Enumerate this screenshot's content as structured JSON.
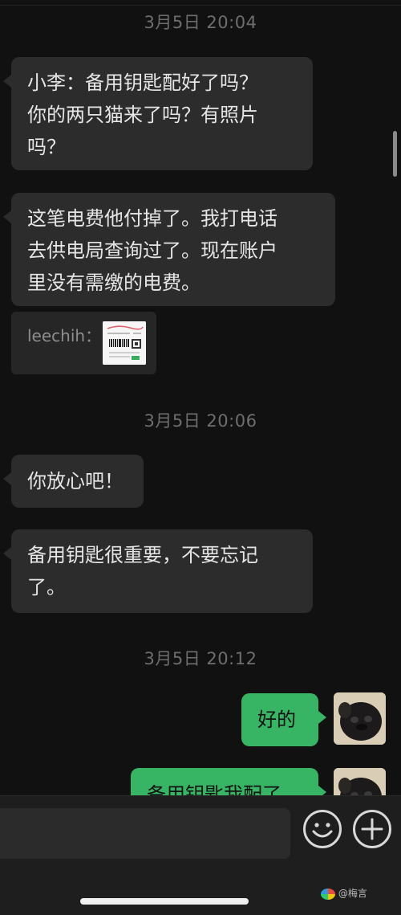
{
  "timestamps": [
    "3月5日 20:04",
    "3月5日 20:06",
    "3月5日 20:12"
  ],
  "messages": {
    "m1": "小李：备用钥匙配好了吗？\n你的两只猫来了吗？有照片\n吗？",
    "m2": "这笔电费他付掉了。我打电话\n去供电局查询过了。现在账户\n里没有需缴的电费。",
    "m3": "你放心吧！",
    "m4": "备用钥匙很重要，不要忘记\n了。",
    "m5": "好的",
    "m6": "备用钥匙我配了"
  },
  "quote": {
    "sender": "leechih："
  },
  "input": {
    "value": "",
    "placeholder": ""
  },
  "watermark": {
    "text": "@梅言"
  },
  "colors": {
    "background": "#111111",
    "incoming_bubble": "#2c2c2c",
    "outgoing_bubble": "#37b464",
    "timestamp": "#6e6e6e"
  },
  "icons": [
    "emoji-icon",
    "plus-icon"
  ]
}
